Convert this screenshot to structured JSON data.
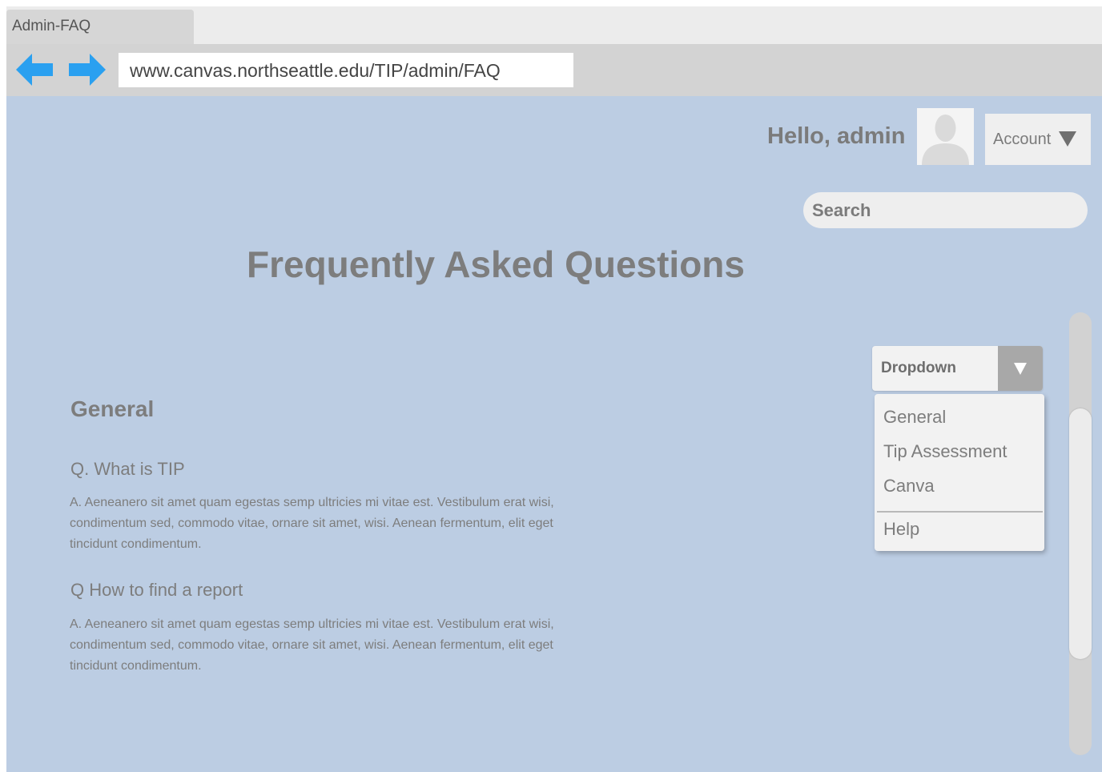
{
  "browser": {
    "tab_title": "Admin-FAQ",
    "url": "www.canvas.northseattle.edu/TIP/admin/FAQ",
    "nav_icon_color": "#2aa0f0"
  },
  "header": {
    "greeting": "Hello, admin",
    "account_label": "Account",
    "search_placeholder": "Search"
  },
  "page": {
    "title": "Frequently Asked Questions",
    "background": "#bccde3",
    "section": {
      "heading": "General",
      "faqs": [
        {
          "question": "Q. What is TIP",
          "answer": "A. Aeneanero sit amet quam egestas semp ultricies mi vitae est. Vestibulum erat wisi, condimentum sed, commodo vitae, ornare sit amet, wisi. Aenean fermentum, elit eget tincidunt condimentum."
        },
        {
          "question": "Q How to find a report",
          "answer": "A. Aeneanero sit amet quam egestas semp ultricies mi vitae est. Vestibulum erat wisi, condimentum sed, commodo vitae, ornare sit amet, wisi. Aenean fermentum, elit eget tincidunt condimentum."
        }
      ]
    }
  },
  "dropdown": {
    "label": "Dropdown",
    "items": [
      "General",
      "Tip Assessment",
      "Canva",
      "Help"
    ]
  }
}
